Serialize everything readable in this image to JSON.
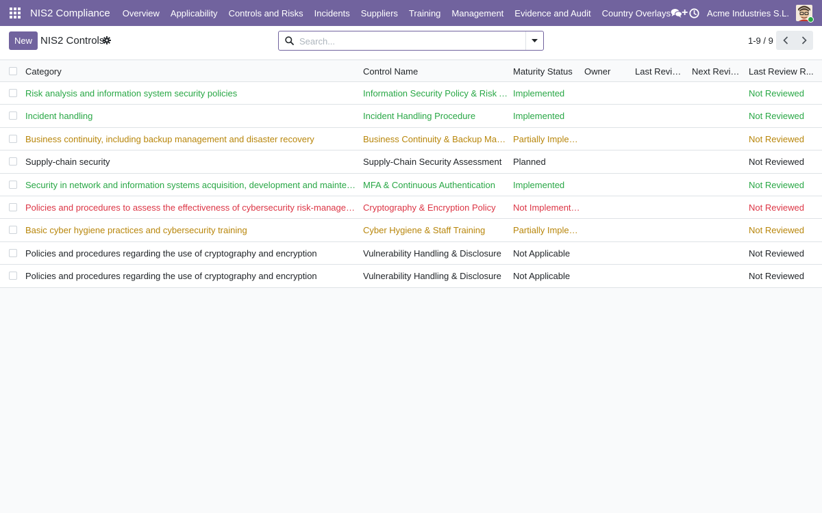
{
  "navbar": {
    "app_name": "NIS2 Compliance",
    "menu": [
      "Overview",
      "Applicability",
      "Controls and Risks",
      "Incidents",
      "Suppliers",
      "Training",
      "Management",
      "Evidence and Audit",
      "Country Overlays"
    ],
    "company": "Acme Industries S.L.",
    "icons": [
      "apps-grid-icon",
      "add-icon",
      "chat-icon",
      "clock-icon",
      "user-avatar"
    ]
  },
  "control_panel": {
    "new_label": "New",
    "title": "NIS2 Controls",
    "search_placeholder": "Search...",
    "pager": "1-9 / 9"
  },
  "table": {
    "headers": {
      "category": "Category",
      "control_name": "Control Name",
      "maturity_status": "Maturity Status",
      "owner": "Owner",
      "last_review": "Last Revie...",
      "next_review": "Next Revie...",
      "last_review_result": "Last Review R..."
    },
    "rows": [
      {
        "category": "Risk analysis and information system security policies",
        "control_name": "Information Security Policy & Risk Ana...",
        "maturity_status": "Implemented",
        "owner": "",
        "last_review": "",
        "next_review": "",
        "last_review_result": "Not Reviewed",
        "status": "green"
      },
      {
        "category": "Incident handling",
        "control_name": "Incident Handling Procedure",
        "maturity_status": "Implemented",
        "owner": "",
        "last_review": "",
        "next_review": "",
        "last_review_result": "Not Reviewed",
        "status": "green"
      },
      {
        "category": "Business continuity, including backup management and disaster recovery",
        "control_name": "Business Continuity & Backup Manag...",
        "maturity_status": "Partially Implem...",
        "owner": "",
        "last_review": "",
        "next_review": "",
        "last_review_result": "Not Reviewed",
        "status": "amber"
      },
      {
        "category": "Supply-chain security",
        "control_name": "Supply-Chain Security Assessment",
        "maturity_status": "Planned",
        "owner": "",
        "last_review": "",
        "next_review": "",
        "last_review_result": "Not Reviewed",
        "status": "plain"
      },
      {
        "category": "Security in network and information systems acquisition, development and maintenance",
        "control_name": "MFA & Continuous Authentication",
        "maturity_status": "Implemented",
        "owner": "",
        "last_review": "",
        "next_review": "",
        "last_review_result": "Not Reviewed",
        "status": "green"
      },
      {
        "category": "Policies and procedures to assess the effectiveness of cybersecurity risk-management mea...",
        "control_name": "Cryptography & Encryption Policy",
        "maturity_status": "Not Implemented",
        "owner": "",
        "last_review": "",
        "next_review": "",
        "last_review_result": "Not Reviewed",
        "status": "red"
      },
      {
        "category": "Basic cyber hygiene practices and cybersecurity training",
        "control_name": "Cyber Hygiene & Staff Training",
        "maturity_status": "Partially Implem...",
        "owner": "",
        "last_review": "",
        "next_review": "",
        "last_review_result": "Not Reviewed",
        "status": "amber"
      },
      {
        "category": "Policies and procedures regarding the use of cryptography and encryption",
        "control_name": "Vulnerability Handling & Disclosure",
        "maturity_status": "Not Applicable",
        "owner": "",
        "last_review": "",
        "next_review": "",
        "last_review_result": "Not Reviewed",
        "status": "plain"
      },
      {
        "category": "Policies and procedures regarding the use of cryptography and encryption",
        "control_name": "Vulnerability Handling & Disclosure",
        "maturity_status": "Not Applicable",
        "owner": "",
        "last_review": "",
        "next_review": "",
        "last_review_result": "Not Reviewed",
        "status": "plain"
      }
    ]
  },
  "colors": {
    "brand": "#71639e",
    "green": "#28a745",
    "amber": "#b8860b",
    "red": "#dc3545"
  }
}
